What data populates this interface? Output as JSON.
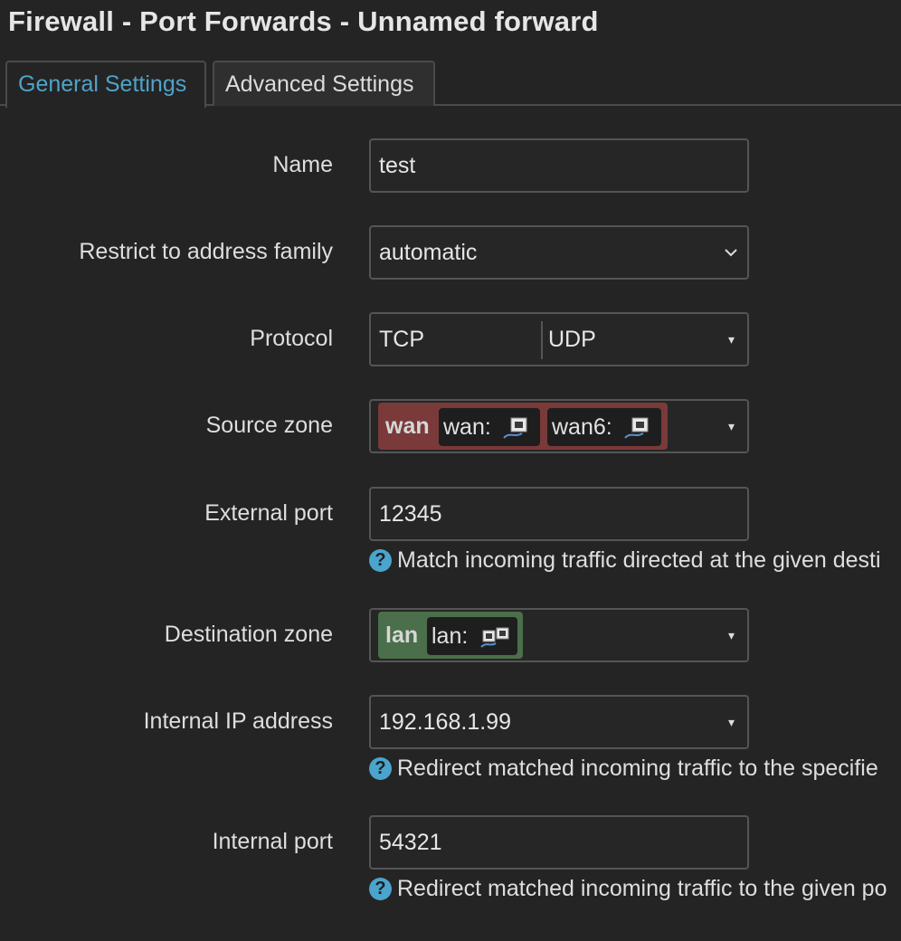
{
  "page": {
    "title": "Firewall - Port Forwards - Unnamed forward"
  },
  "tabs": [
    {
      "label": "General Settings",
      "active": true
    },
    {
      "label": "Advanced Settings",
      "active": false
    }
  ],
  "form": {
    "name": {
      "label": "Name",
      "value": "test"
    },
    "family": {
      "label": "Restrict to address family",
      "value": "automatic"
    },
    "protocol": {
      "label": "Protocol",
      "values": [
        "TCP",
        "UDP"
      ]
    },
    "source_zone": {
      "label": "Source zone",
      "zone": "wan",
      "networks": [
        "wan:",
        "wan6:"
      ],
      "color": "#7a3a3a"
    },
    "external_port": {
      "label": "External port",
      "value": "12345",
      "help": "Match incoming traffic directed at the given desti"
    },
    "dest_zone": {
      "label": "Destination zone",
      "zone": "lan",
      "networks": [
        "lan:"
      ],
      "color": "#4a6f4a"
    },
    "internal_ip": {
      "label": "Internal IP address",
      "value": "192.168.1.99",
      "help": "Redirect matched incoming traffic to the specifie"
    },
    "internal_port": {
      "label": "Internal port",
      "value": "54321",
      "help": "Redirect matched incoming traffic to the given po"
    }
  },
  "icons": {
    "help": "?",
    "dropdown": "▾",
    "select_chevron": "chevron-down-icon",
    "network": "network-interface-icon"
  },
  "colors": {
    "accent": "#4fa3c9",
    "help_icon": "#4ba4cc"
  }
}
